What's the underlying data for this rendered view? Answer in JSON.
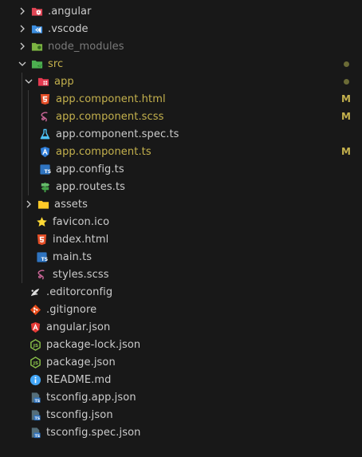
{
  "explorer": {
    "colors": {
      "background": "#181818",
      "text": "#cccccc",
      "modified": "#c4b14d",
      "ignored": "#7a7a7a"
    },
    "items": [
      {
        "label": ".angular",
        "icon": "angular-folder-icon"
      },
      {
        "label": ".vscode",
        "icon": "vscode-folder-icon"
      },
      {
        "label": "node_modules",
        "icon": "node-folder-icon"
      },
      {
        "label": "src",
        "icon": "src-folder-icon"
      },
      {
        "label": "app",
        "icon": "app-folder-icon"
      },
      {
        "label": "app.component.html",
        "icon": "html-file-icon",
        "status": "M"
      },
      {
        "label": "app.component.scss",
        "icon": "sass-file-icon",
        "status": "M"
      },
      {
        "label": "app.component.spec.ts",
        "icon": "test-flask-icon"
      },
      {
        "label": "app.component.ts",
        "icon": "angular-component-icon",
        "status": "M"
      },
      {
        "label": "app.config.ts",
        "icon": "typescript-file-icon"
      },
      {
        "label": "app.routes.ts",
        "icon": "routes-signpost-icon"
      },
      {
        "label": "assets",
        "icon": "assets-folder-icon"
      },
      {
        "label": "favicon.ico",
        "icon": "star-favicon-icon"
      },
      {
        "label": "index.html",
        "icon": "html-file-icon"
      },
      {
        "label": "main.ts",
        "icon": "typescript-file-icon"
      },
      {
        "label": "styles.scss",
        "icon": "sass-file-icon"
      },
      {
        "label": ".editorconfig",
        "icon": "editorconfig-icon"
      },
      {
        "label": ".gitignore",
        "icon": "git-icon"
      },
      {
        "label": "angular.json",
        "icon": "angular-logo-icon"
      },
      {
        "label": "package-lock.json",
        "icon": "nodejs-hexagon-icon"
      },
      {
        "label": "package.json",
        "icon": "nodejs-hexagon-icon"
      },
      {
        "label": "README.md",
        "icon": "info-circle-icon"
      },
      {
        "label": "tsconfig.app.json",
        "icon": "tsconfig-icon"
      },
      {
        "label": "tsconfig.json",
        "icon": "tsconfig-icon"
      },
      {
        "label": "tsconfig.spec.json",
        "icon": "tsconfig-icon"
      }
    ]
  }
}
